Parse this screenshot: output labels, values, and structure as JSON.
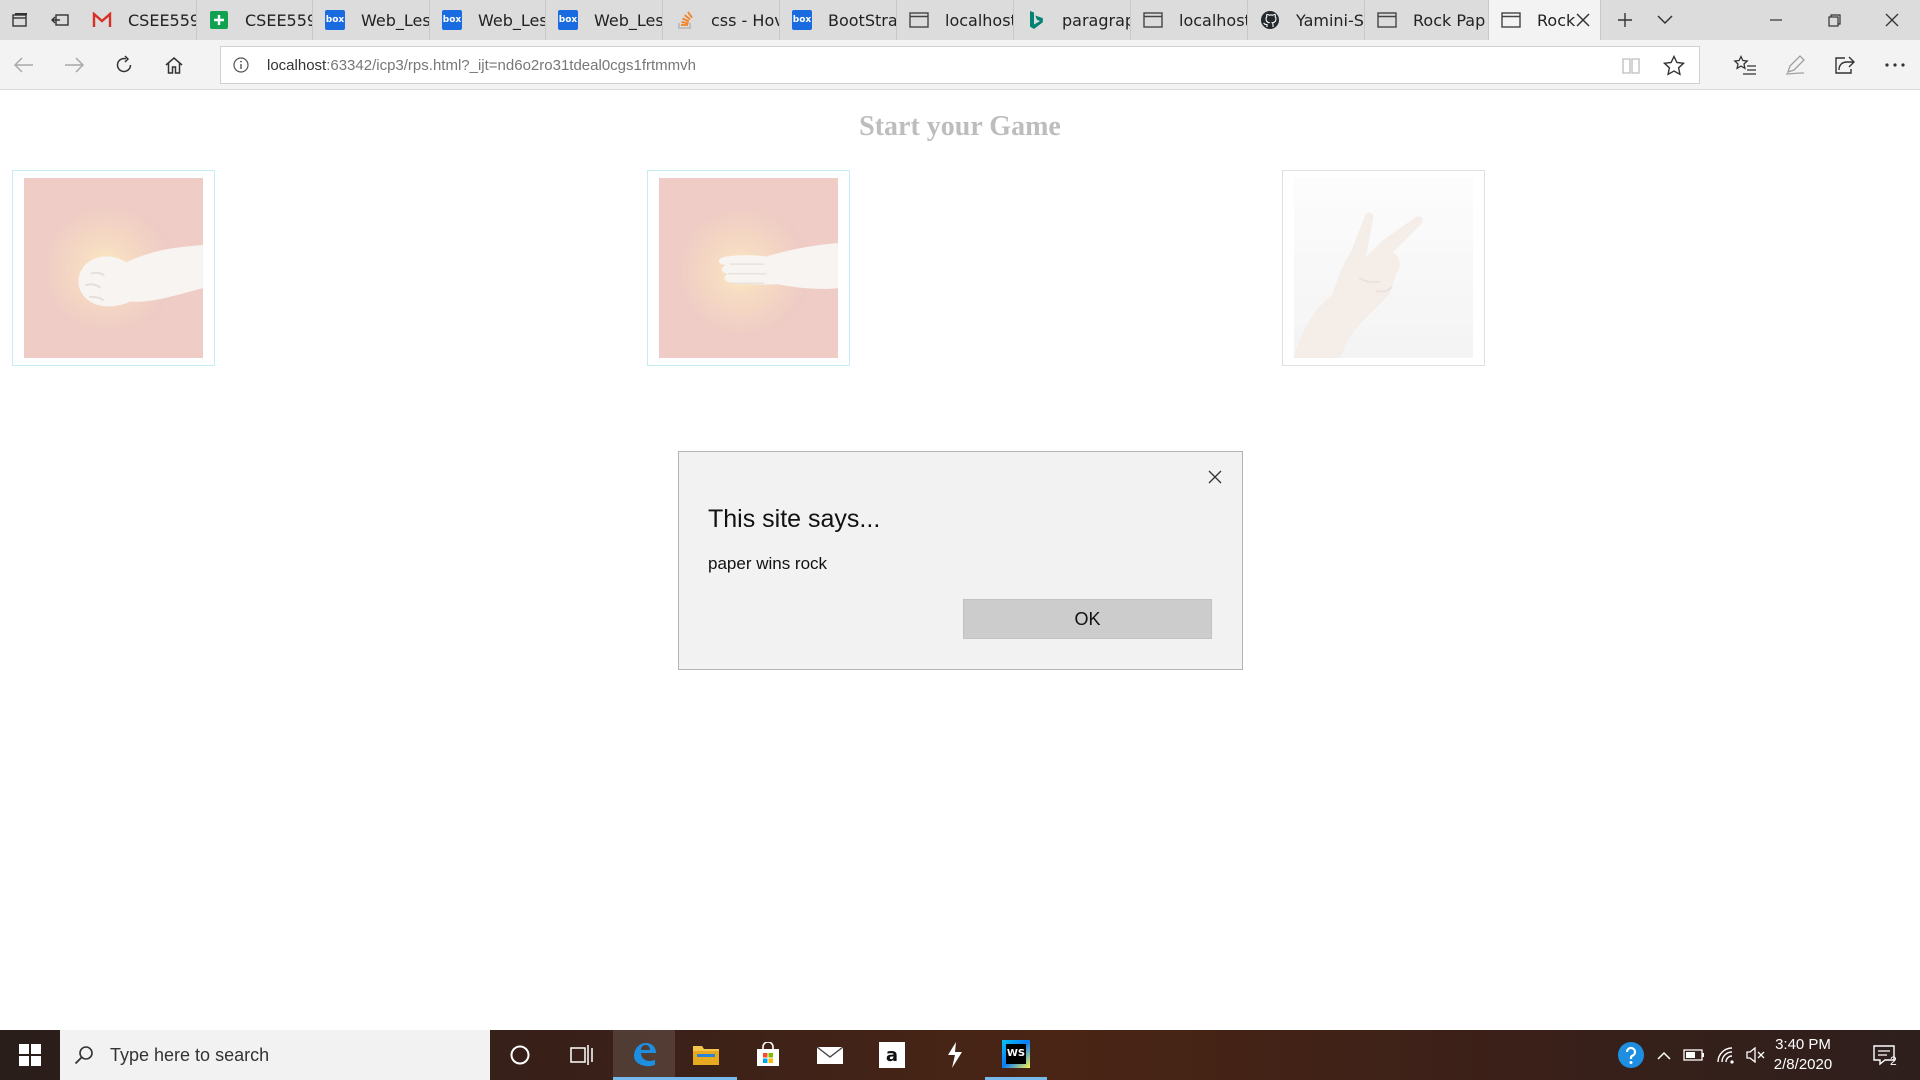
{
  "browser": {
    "tabs": [
      {
        "label": "CSEE559",
        "icon": "gmail-icon"
      },
      {
        "label": "CSEE559",
        "icon": "sheets-plus-icon"
      },
      {
        "label": "Web_Les",
        "icon": "box-icon"
      },
      {
        "label": "Web_Les",
        "icon": "box-icon"
      },
      {
        "label": "Web_Les",
        "icon": "box-icon"
      },
      {
        "label": "css - Hov",
        "icon": "stackoverflow-icon"
      },
      {
        "label": "BootStra|",
        "icon": "box-icon"
      },
      {
        "label": "localhost",
        "icon": "page-icon"
      },
      {
        "label": "paragrap",
        "icon": "bing-icon"
      },
      {
        "label": "localhost",
        "icon": "page-icon"
      },
      {
        "label": "Yamini-S",
        "icon": "github-icon"
      },
      {
        "label": "Rock Pap",
        "icon": "page-icon"
      },
      {
        "label": "Rock",
        "icon": "page-icon",
        "active": true
      }
    ],
    "box_icon_text": "box",
    "url_host": "localhost",
    "url_rest": ":63342/icp3/rps.html?_ijt=nd6o2ro31tdeal0cgs1frtmmvh"
  },
  "page": {
    "title": "Start your Game",
    "choices": [
      {
        "name": "rock",
        "selected": true
      },
      {
        "name": "paper",
        "selected": true
      },
      {
        "name": "scissors",
        "selected": false
      }
    ]
  },
  "dialog": {
    "title": "This site says...",
    "message": "paper wins rock",
    "ok_label": "OK"
  },
  "taskbar": {
    "search_placeholder": "Type here to search",
    "amazon_glyph": "a",
    "webstorm_glyph": "WS",
    "time": "3:40 PM",
    "date": "2/8/2020",
    "notification_count": "2"
  },
  "colors": {
    "accent": "#0078d7",
    "card_highlight": "#a8e4f1",
    "title_gray": "#9a9a9a"
  }
}
